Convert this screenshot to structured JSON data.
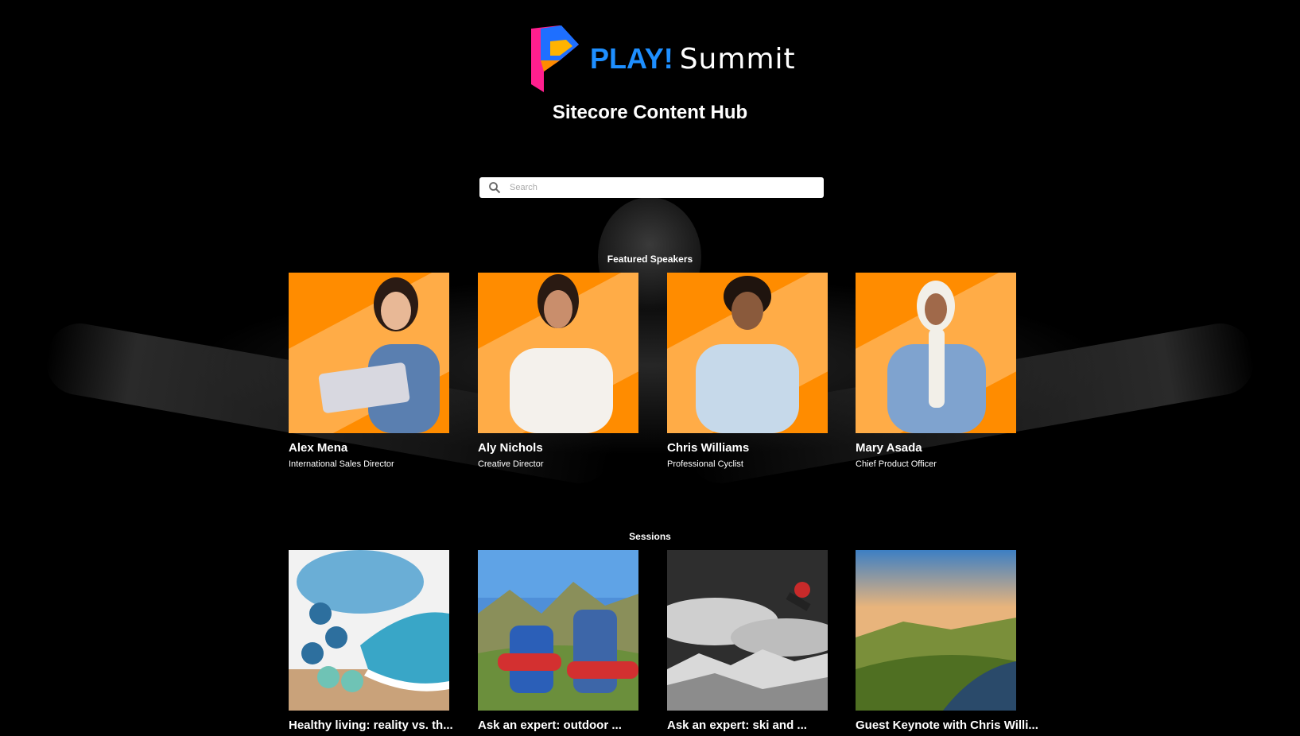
{
  "header": {
    "logo_play": "PLAY!",
    "logo_summit": "Summit",
    "title": "Sitecore Content Hub"
  },
  "search": {
    "placeholder": "Search"
  },
  "speakers": {
    "heading": "Featured Speakers",
    "items": [
      {
        "name": "Alex Mena",
        "role": "International Sales Director"
      },
      {
        "name": "Aly Nichols",
        "role": "Creative Director"
      },
      {
        "name": "Chris Williams",
        "role": "Professional Cyclist"
      },
      {
        "name": "Mary Asada",
        "role": "Chief Product Officer"
      }
    ]
  },
  "sessions": {
    "heading": "Sessions",
    "items": [
      {
        "title": "Healthy living: reality vs. th..."
      },
      {
        "title": "Ask an expert: outdoor ..."
      },
      {
        "title": "Ask an expert: ski and ..."
      },
      {
        "title": "Guest Keynote with Chris Willi..."
      }
    ]
  },
  "colors": {
    "background": "#000000",
    "accent_orange": "#ff8c00",
    "play_blue": "#1e8fff"
  }
}
